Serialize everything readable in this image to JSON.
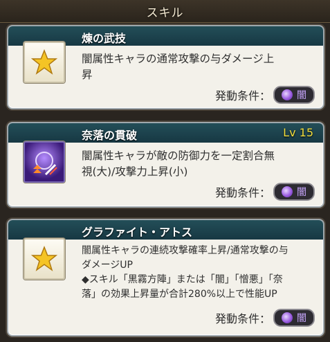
{
  "header": {
    "title": "スキル"
  },
  "skills": [
    {
      "name": "煉の武技",
      "level": "",
      "description": [
        "闇属性キャラの通常攻撃の与ダメージ上",
        "昇"
      ],
      "condition_label": "発動条件：",
      "element": "闇",
      "icon": "gold-star-icon"
    },
    {
      "name": "奈落の貫破",
      "level": "Lv 15",
      "description": [
        "闇属性キャラが敵の防御力を一定割合無",
        "視(大)/攻撃力上昇(小)"
      ],
      "condition_label": "発動条件：",
      "element": "闇",
      "icon": "defense-break-icon"
    },
    {
      "name": "グラファイト・アトス",
      "level": "",
      "description": [
        "闇属性キャラの連続攻撃確率上昇/通常攻撃の与",
        "ダメージUP",
        "◆スキル「黒霧方陣」または「闇」「憎悪」「奈",
        "落」の効果上昇量が合計280%以上で性能UP"
      ],
      "condition_label": "発動条件：",
      "element": "闇",
      "icon": "gold-star-icon"
    }
  ],
  "colors": {
    "title_bar": "#1d4450",
    "level": "#f2dd3c",
    "card": "#f3f1ea",
    "dark_element": "#9a5ce0"
  }
}
